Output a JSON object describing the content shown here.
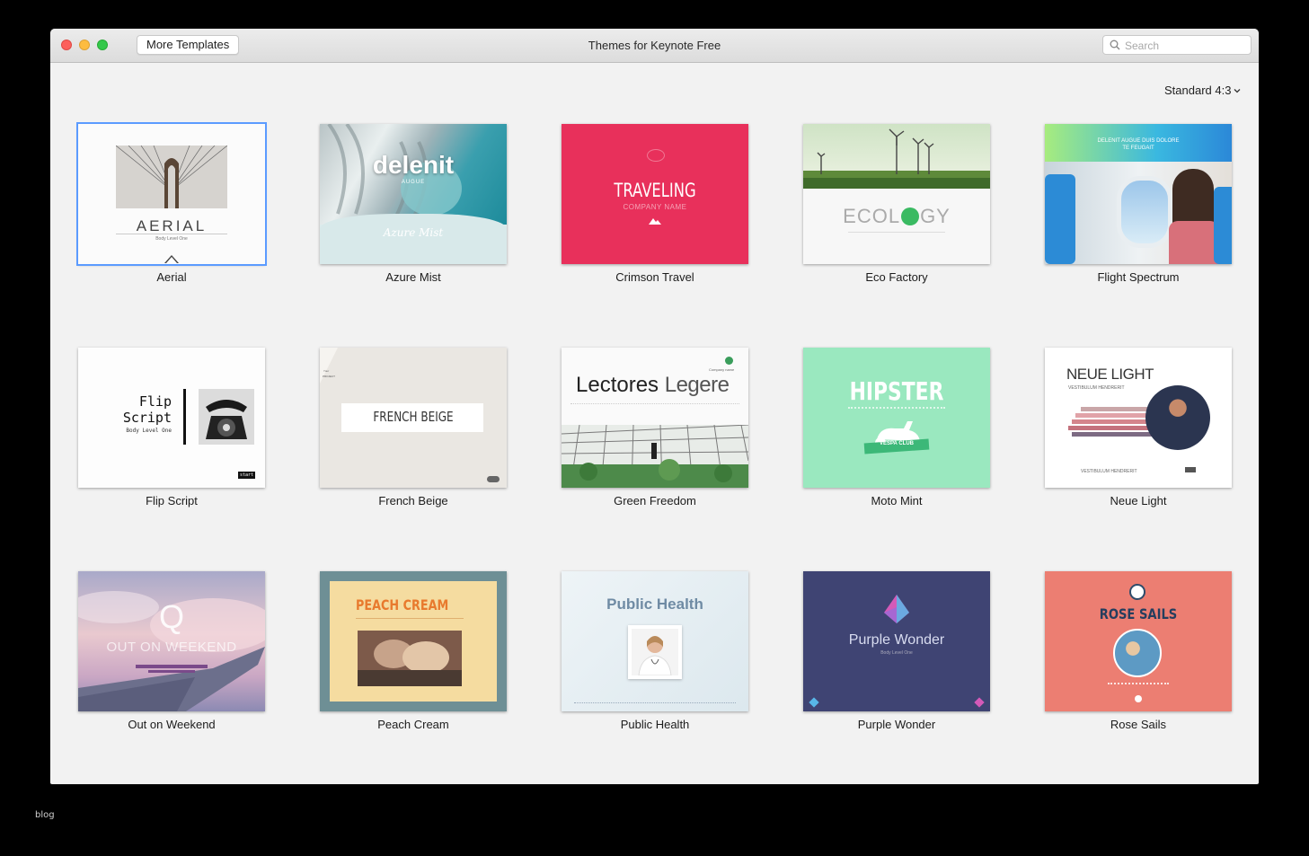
{
  "window": {
    "title": "Themes for Keynote Free",
    "more_templates_label": "More Templates",
    "search_placeholder": "Search",
    "size_selector": "Standard 4:3"
  },
  "themes": [
    {
      "name": "Aerial",
      "selected": true,
      "thumb": {
        "title": "AERIAL",
        "sub": "Body Level One"
      }
    },
    {
      "name": "Azure Mist",
      "thumb": {
        "title": "delenit",
        "tag": "AUGUE",
        "script": "Azure Mist"
      }
    },
    {
      "name": "Crimson Travel",
      "thumb": {
        "title": "TRAVELING",
        "sub": "COMPANY NAME"
      }
    },
    {
      "name": "Eco Factory",
      "thumb": {
        "title_a": "ECOL",
        "title_b": "GY"
      }
    },
    {
      "name": "Flight Spectrum",
      "thumb": {
        "line1": "DELENIT AUGUE DUIS DOLORE",
        "line2": "TE FEUGAIT"
      }
    },
    {
      "name": "Flip Script",
      "thumb": {
        "title1": "Flip",
        "title2": "Script",
        "sub": "Body Level One",
        "tag": "start"
      }
    },
    {
      "name": "French Beige",
      "thumb": {
        "title": "FRENCH BEIGE",
        "corner1": "Your",
        "corner2": "PROJECT"
      }
    },
    {
      "name": "Green Freedom",
      "thumb": {
        "title_a": "Lectores",
        "title_b": "Legere",
        "company": "Company name"
      }
    },
    {
      "name": "Moto Mint",
      "thumb": {
        "title": "HIPSTER",
        "badge": "VESPA CLUB"
      }
    },
    {
      "name": "Neue Light",
      "thumb": {
        "title": "NEUE LIGHT",
        "sub": "VESTIBULUM HENDRERIT",
        "footer": "VESTIBULUM HENDRERIT"
      }
    },
    {
      "name": "Out on Weekend",
      "thumb": {
        "letter": "Q",
        "title": "OUT ON WEEKEND"
      }
    },
    {
      "name": "Peach Cream",
      "thumb": {
        "title": "PEACH CREAM"
      }
    },
    {
      "name": "Public Health",
      "thumb": {
        "title": "Public Health"
      }
    },
    {
      "name": "Purple Wonder",
      "thumb": {
        "title": "Purple Wonder",
        "sub": "Body Level One"
      }
    },
    {
      "name": "Rose Sails",
      "thumb": {
        "title": "ROSE SAILS"
      }
    }
  ],
  "watermark": "blog",
  "colors": {
    "selection": "#5b9bff",
    "crimson": "#e8305b",
    "mint": "#9ae8bf",
    "rose": "#ec7e72",
    "purple": "#3f4473",
    "peach_border": "#6e8f95"
  }
}
